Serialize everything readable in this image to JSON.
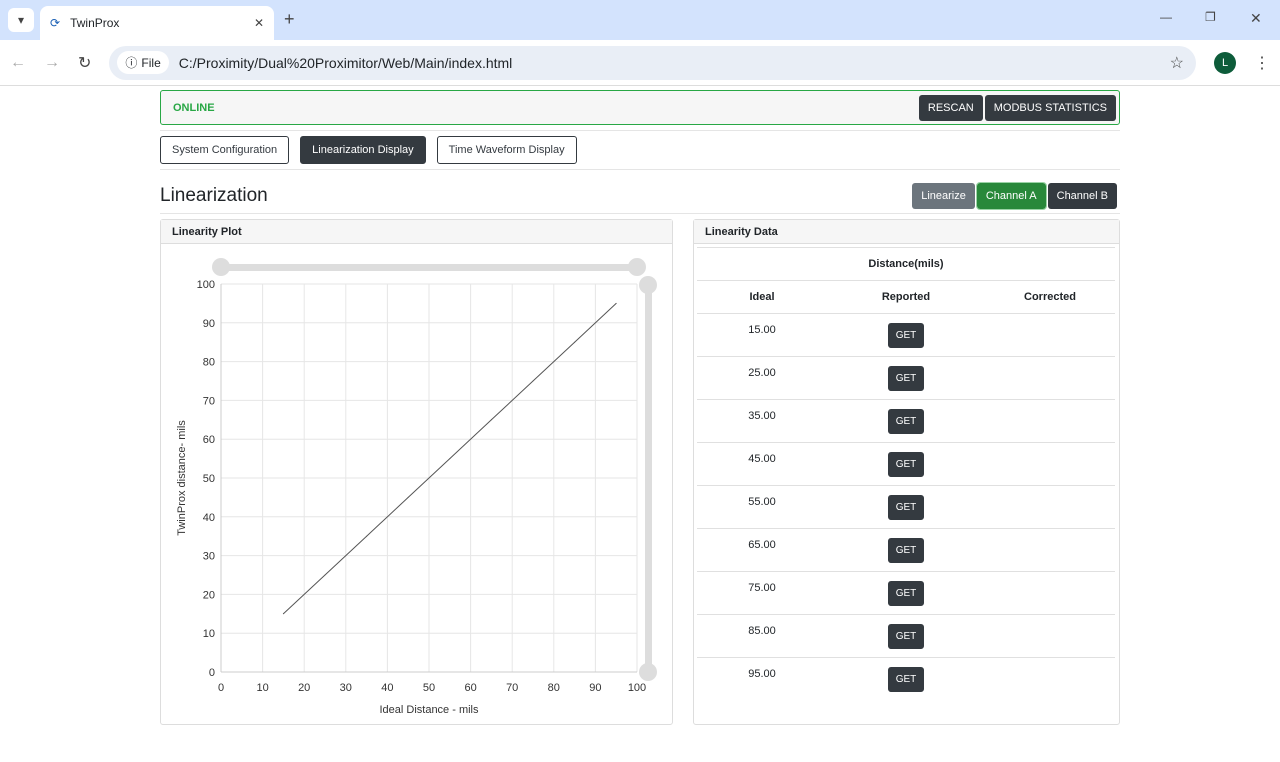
{
  "browser": {
    "tab_title": "TwinProx",
    "url": "C:/Proximity/Dual%20Proximitor/Web/Main/index.html",
    "file_chip": "File",
    "profile_initial": "L"
  },
  "status": {
    "text": "ONLINE",
    "rescan": "RESCAN",
    "modbus": "MODBUS STATISTICS",
    "accent": "#28a745"
  },
  "nav": [
    {
      "label": "System Configuration",
      "active": false
    },
    {
      "label": "Linearization Display",
      "active": true
    },
    {
      "label": "Time Waveform Display",
      "active": false
    }
  ],
  "header": {
    "title": "Linearization",
    "linearize": "Linearize",
    "channel_a": "Channel A",
    "channel_b": "Channel B"
  },
  "plot_card": {
    "title": "Linearity Plot"
  },
  "data_card": {
    "title": "Linearity Data",
    "group_header": "Distance(mils)",
    "columns": [
      "Ideal",
      "Reported",
      "Corrected"
    ],
    "get_label": "GET",
    "rows": [
      "15.00",
      "25.00",
      "35.00",
      "45.00",
      "55.00",
      "65.00",
      "75.00",
      "85.00",
      "95.00"
    ]
  },
  "chart_data": {
    "type": "line",
    "xlabel": "Ideal Distance - mils",
    "ylabel": "TwinProx distance- mils",
    "xlim": [
      0,
      100
    ],
    "ylim": [
      0,
      100
    ],
    "xticks": [
      0,
      10,
      20,
      30,
      40,
      50,
      60,
      70,
      80,
      90,
      100
    ],
    "yticks": [
      0,
      10,
      20,
      30,
      40,
      50,
      60,
      70,
      80,
      90,
      100
    ],
    "grid": true,
    "x": [
      15,
      25,
      35,
      45,
      55,
      65,
      75,
      85,
      95
    ],
    "y": [
      15,
      25,
      35,
      45,
      55,
      65,
      75,
      85,
      95
    ],
    "line_color": "#555555"
  }
}
